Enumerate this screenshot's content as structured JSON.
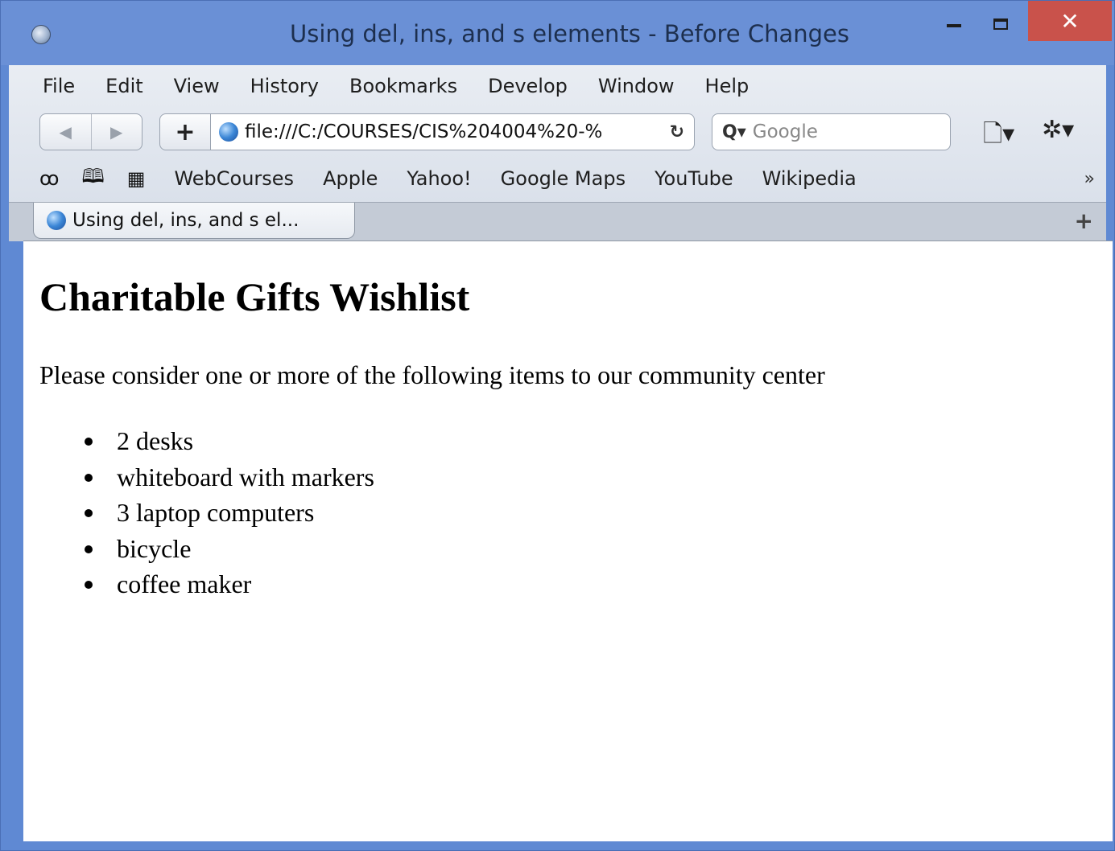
{
  "window": {
    "title": "Using del, ins, and s elements - Before Changes",
    "close_glyph": "✕"
  },
  "menu": [
    "File",
    "Edit",
    "View",
    "History",
    "Bookmarks",
    "Develop",
    "Window",
    "Help"
  ],
  "toolbar": {
    "back_glyph": "◀",
    "forward_glyph": "▶",
    "add_glyph": "+",
    "url": "file:///C:/COURSES/CIS%204004%20-%",
    "reload_glyph": "↻",
    "search_placeholder": "Google",
    "search_glyph": "Q▾",
    "page_menu_glyph": "🗋▾",
    "settings_glyph": "✲▾"
  },
  "bookmarks": {
    "reading_list_glyph": "ꝏ",
    "bookmarks_glyph": "🕮",
    "top_sites_glyph": "▦",
    "items": [
      "WebCourses",
      "Apple",
      "Yahoo!",
      "Google Maps",
      "YouTube",
      "Wikipedia"
    ],
    "more_glyph": "»"
  },
  "tabs": [
    {
      "label": "Using del, ins, and s el..."
    }
  ],
  "new_tab_glyph": "+",
  "page": {
    "heading": "Charitable Gifts Wishlist",
    "intro": "Please consider one or more of the following items to our community center",
    "items": [
      "2 desks",
      "whiteboard with markers",
      "3 laptop computers",
      "bicycle",
      "coffee maker"
    ]
  }
}
